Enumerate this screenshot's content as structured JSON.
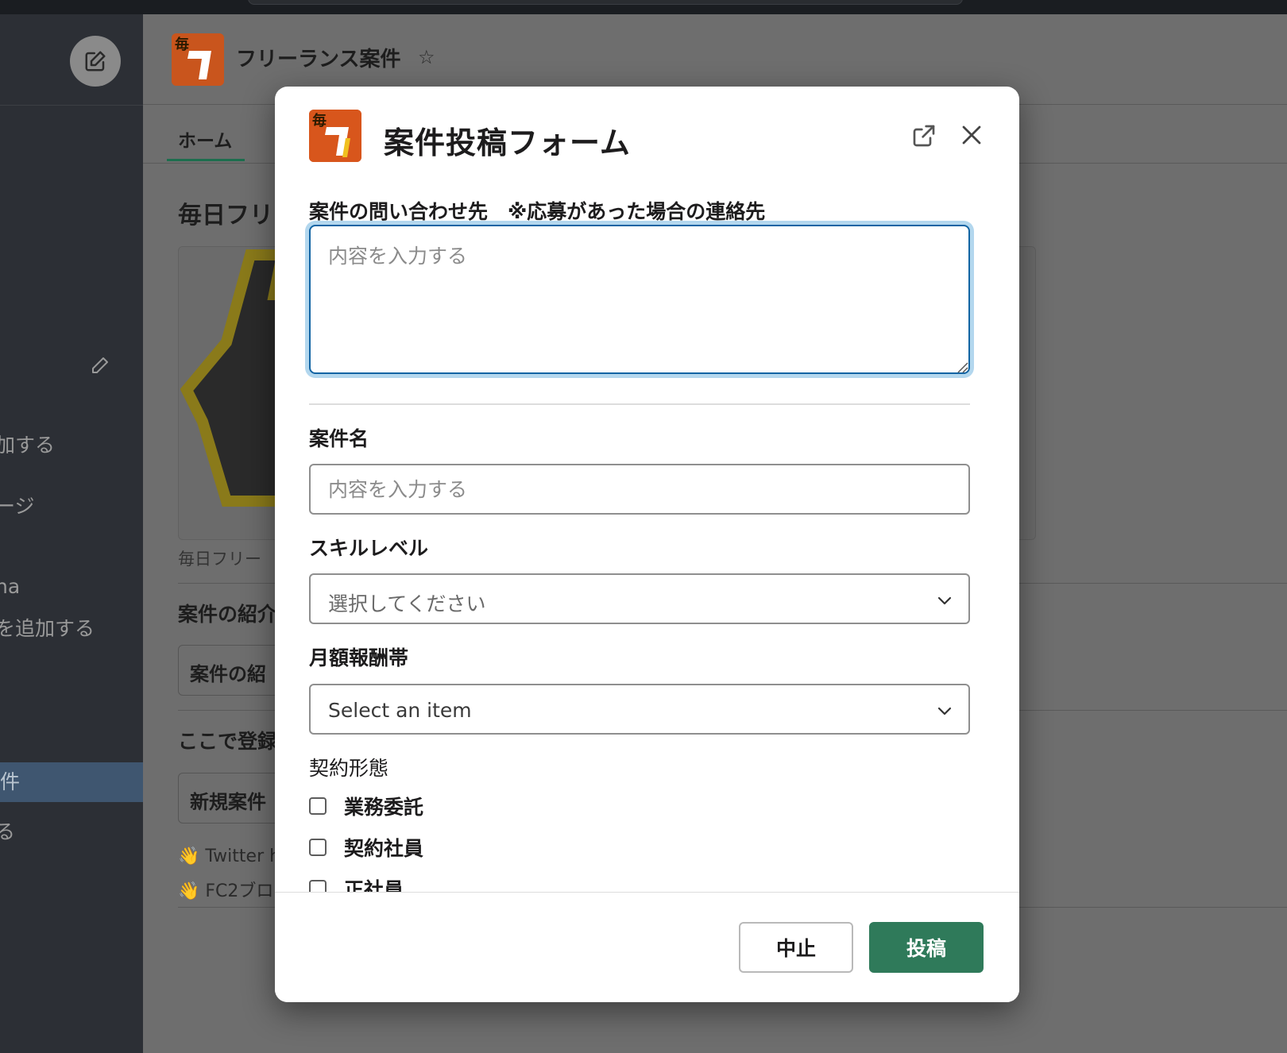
{
  "channel": {
    "title": "フリーランス案件",
    "logo_text": "毎フリ",
    "tabs": [
      {
        "label": "ホーム"
      }
    ]
  },
  "background": {
    "heading": "毎日フリ",
    "caption": "毎日フリー",
    "section1": "案件の紹介",
    "section1_button": "案件の紹",
    "section2": "ここで登録",
    "section2_button": "新規案件",
    "link1": "👋 Twitter h",
    "link2": "👋 FC2ブロ"
  },
  "sidebar": {
    "items": [
      {
        "label": "加する"
      },
      {
        "label": "ージ"
      },
      {
        "label": "na"
      },
      {
        "label": "を追加する"
      },
      {
        "label": "件"
      },
      {
        "label": "る"
      }
    ]
  },
  "modal": {
    "title": "案件投稿フォーム",
    "fields": {
      "contact": {
        "label": "案件の問い合わせ先　※応募があった場合の連絡先",
        "placeholder": "内容を入力する"
      },
      "name": {
        "label": "案件名",
        "placeholder": "内容を入力する"
      },
      "skill": {
        "label": "スキルレベル",
        "selected": "選択してください"
      },
      "pay": {
        "label": "月額報酬帯",
        "selected": "Select an item"
      },
      "contract": {
        "label": "契約形態",
        "options": [
          {
            "label": "業務委託",
            "checked": false
          },
          {
            "label": "契約社員",
            "checked": false
          },
          {
            "label": "正社員",
            "checked": false
          }
        ]
      }
    },
    "buttons": {
      "cancel": "中止",
      "submit": "投稿"
    }
  },
  "colors": {
    "accent": "#2f7a5a",
    "focus": "#1264a3",
    "logo": "#d8561c"
  }
}
